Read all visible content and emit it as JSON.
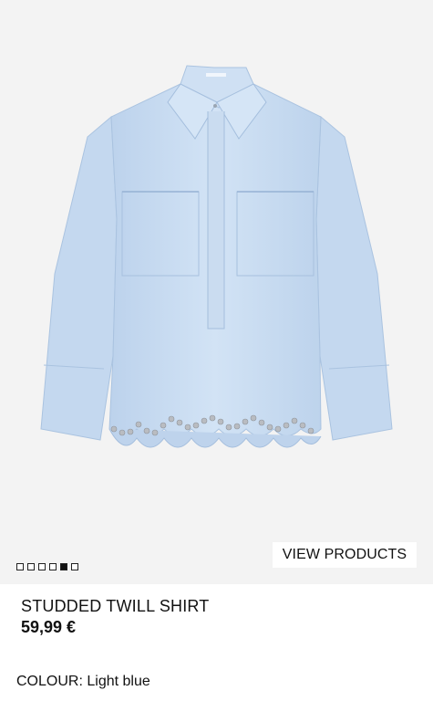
{
  "product": {
    "name": "STUDDED TWILL SHIRT",
    "price": "59,99 €",
    "colour_label": "COLOUR:",
    "colour_value": "Light blue",
    "shirt_color": "#c9dcf1",
    "stud_color": "#b9bcc1"
  },
  "gallery": {
    "view_products_label": "VIEW PRODUCTS",
    "image_count": 6,
    "active_index": 5
  }
}
